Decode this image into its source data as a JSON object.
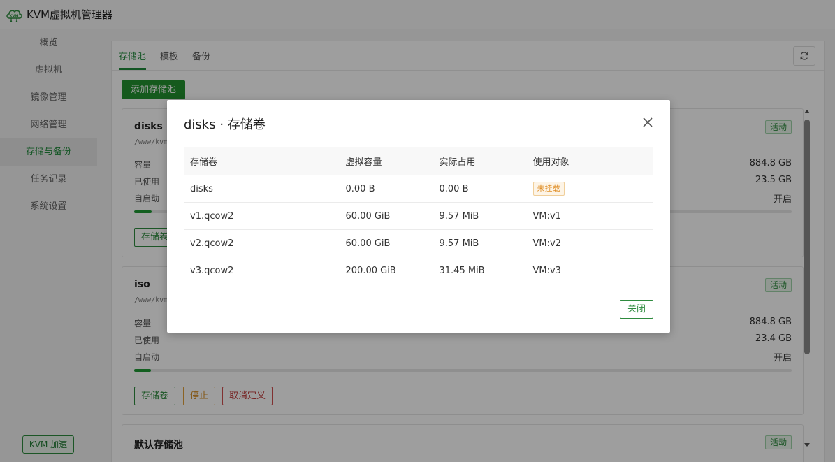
{
  "app": {
    "title": "KVM虚拟机管理器",
    "logo_text": "KVM"
  },
  "sidebar": {
    "items": [
      {
        "label": "概览"
      },
      {
        "label": "虚拟机"
      },
      {
        "label": "镜像管理"
      },
      {
        "label": "网络管理"
      },
      {
        "label": "存储与备份",
        "active": true
      },
      {
        "label": "任务记录"
      },
      {
        "label": "系统设置"
      }
    ],
    "accel_button": "KVM 加速"
  },
  "tabs": [
    {
      "label": "存储池",
      "active": true
    },
    {
      "label": "模板"
    },
    {
      "label": "备份"
    }
  ],
  "toolbar": {
    "add_pool": "添加存储池"
  },
  "pools": [
    {
      "name": "disks",
      "path": "/www/kvm",
      "status": "活动",
      "capacity_label": "容量",
      "capacity": "884.8 GB",
      "used_label": "已使用",
      "used": "23.5 GB",
      "autostart_label": "自启动",
      "autostart": "开启",
      "usage_percent": 2.7,
      "volumes_button": "存储卷"
    },
    {
      "name": "iso",
      "path": "/www/kvm",
      "status": "活动",
      "capacity_label": "容量",
      "capacity": "884.8 GB",
      "used_label": "已使用",
      "used": "23.4 GB",
      "autostart_label": "自启动",
      "autostart": "开启",
      "usage_percent": 2.6,
      "volumes_button": "存储卷",
      "stop_button": "停止",
      "undefine_button": "取消定义"
    },
    {
      "name": "默认存储池",
      "status": "活动"
    }
  ],
  "modal": {
    "title": "disks · 存储卷",
    "columns": [
      "存储卷",
      "虚拟容量",
      "实际占用",
      "使用对象"
    ],
    "rows": [
      {
        "name": "disks",
        "virtual": "0.00 B",
        "actual": "0.00 B",
        "used_by": "未挂载",
        "unmounted": true
      },
      {
        "name": "v1.qcow2",
        "virtual": "60.00 GiB",
        "actual": "9.57 MiB",
        "used_by": "VM:v1"
      },
      {
        "name": "v2.qcow2",
        "virtual": "60.00 GiB",
        "actual": "9.57 MiB",
        "used_by": "VM:v2"
      },
      {
        "name": "v3.qcow2",
        "virtual": "200.00 GiB",
        "actual": "31.45 MiB",
        "used_by": "VM:v3"
      }
    ],
    "close_button": "关闭"
  },
  "colors": {
    "accent": "#1f8a3a",
    "warning": "#e0902a",
    "danger": "#c03c3c"
  }
}
